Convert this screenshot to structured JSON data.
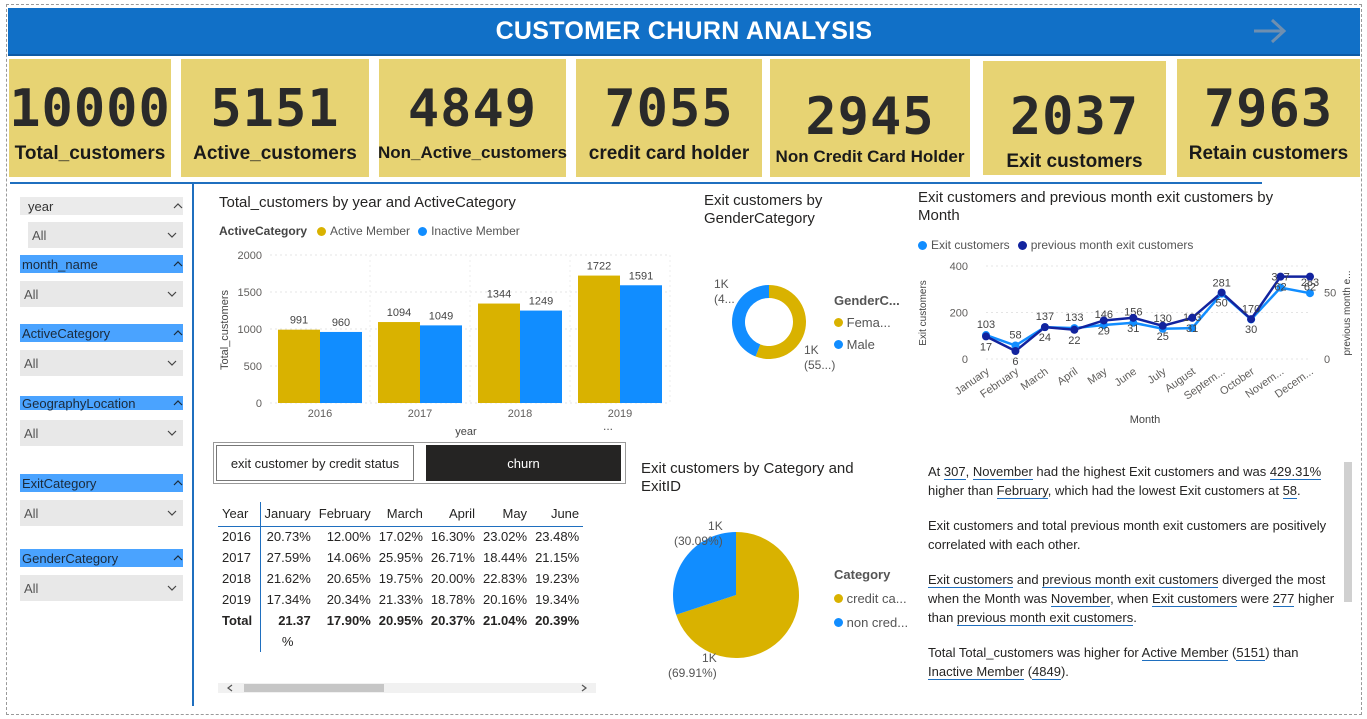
{
  "header": {
    "title": "CUSTOMER CHURN ANALYSIS",
    "nav_icon": "arrow-right-icon"
  },
  "kpis": [
    {
      "value": "10000",
      "label": "Total_customers"
    },
    {
      "value": "5151",
      "label": "Active_customers"
    },
    {
      "value": "4849",
      "label": "Non_Active_customers"
    },
    {
      "value": "7055",
      "label": "credit card holder"
    },
    {
      "value": "2945",
      "label": "Non Credit Card Holder"
    },
    {
      "value": "2037",
      "label": "Exit customers"
    },
    {
      "value": "7963",
      "label": "Retain customers"
    }
  ],
  "slicers": [
    {
      "field": "year",
      "selected": "All"
    },
    {
      "field": "month_name",
      "selected": "All"
    },
    {
      "field": "ActiveCategory",
      "selected": "All"
    },
    {
      "field": "GeographyLocation",
      "selected": "All"
    },
    {
      "field": "ExitCategory",
      "selected": "All"
    },
    {
      "field": "GenderCategory",
      "selected": "All"
    }
  ],
  "colors": {
    "gold": "#d9b200",
    "blue": "#118dff",
    "navy": "#12239e",
    "header": "#1170c7",
    "kpi_bg": "#e7d373"
  },
  "bar_chart": {
    "title": "Total_customers by year and ActiveCategory",
    "legend_title": "ActiveCategory",
    "xlabel": "year",
    "ylabel": "Total_customers",
    "yticks": [
      "2000",
      "1500",
      "1000",
      "500",
      "0"
    ],
    "more_icon": "..."
  },
  "donut": {
    "title_line1": "Exit customers by",
    "title_line2": "GenderCategory",
    "legend_title": "GenderC...",
    "legend": [
      "Fema...",
      "Male"
    ],
    "label_left_1": "1K",
    "label_left_2": "(4...",
    "label_right_1": "1K",
    "label_right_2": "(55...)"
  },
  "line_chart": {
    "title_line1": "Exit customers and previous month exit customers by",
    "title_line2": "Month",
    "legend": [
      "Exit customers",
      "previous month exit customers"
    ],
    "xlabel": "Month",
    "ylabel_left": "Exit customers",
    "ylabel_right": "previous month e...",
    "yticks_left": [
      "400",
      "200",
      "0"
    ],
    "yticks_right": [
      "50",
      "0"
    ],
    "months": [
      "January",
      "February",
      "March",
      "April",
      "May",
      "June",
      "July",
      "August",
      "Septem...",
      "October",
      "Novem...",
      "Decem..."
    ]
  },
  "toggle": {
    "left": "exit customer by credit status",
    "right": "churn"
  },
  "matrix": {
    "columns": [
      "Year",
      "January",
      "February",
      "March",
      "April",
      "May",
      "June"
    ],
    "rows": [
      [
        "2016",
        "20.73%",
        "12.00%",
        "17.02%",
        "16.30%",
        "23.02%",
        "23.48%"
      ],
      [
        "2017",
        "27.59%",
        "14.06%",
        "25.95%",
        "26.71%",
        "18.44%",
        "21.15%"
      ],
      [
        "2018",
        "21.62%",
        "20.65%",
        "19.75%",
        "20.00%",
        "22.83%",
        "19.23%"
      ],
      [
        "2019",
        "17.34%",
        "20.34%",
        "21.33%",
        "18.78%",
        "20.16%",
        "19.34%"
      ]
    ],
    "total": [
      "Total",
      "21.37",
      "17.90%",
      "20.95%",
      "20.37%",
      "21.04%",
      "20.39%"
    ],
    "total_wrap": "%"
  },
  "pie": {
    "title_line1": "Exit customers by Category and",
    "title_line2": "ExitID",
    "legend_title": "Category",
    "legend": [
      "credit ca...",
      "non cred..."
    ],
    "label_top_1": "1K",
    "label_top_2": "(30.09%)",
    "label_bottom_1": "1K",
    "label_bottom_2": "(69.91%)"
  },
  "narrative": {
    "p1": {
      "a": "At ",
      "b": "307",
      "c": ", ",
      "d": "November",
      "e": " had the highest Exit customers and was ",
      "f": "429.31%",
      "g": " higher than ",
      "h": "February",
      "i": ", which had the lowest Exit customers at ",
      "j": "58",
      "k": "."
    },
    "p2": "Exit customers and total previous month exit customers are positively correlated with each other.",
    "p3": {
      "a": "Exit customers",
      "b": " and ",
      "c": "previous month exit customers",
      "d": " diverged the most when the Month was ",
      "e": "November",
      "f": ", when ",
      "g": "Exit customers",
      "h": " were ",
      "i": "277",
      "j": " higher than ",
      "k": "previous month exit customers",
      "l": "."
    },
    "p4": {
      "a": "Total Total_customers was higher for ",
      "b": "Active Member",
      "c": " (",
      "d": "5151",
      "e": ") than ",
      "f": "Inactive Member",
      "g": " (",
      "h": "4849",
      "i": ")."
    }
  },
  "chart_data": [
    {
      "type": "bar",
      "title": "Total_customers by year and ActiveCategory",
      "categories": [
        "2016",
        "2017",
        "2018",
        "2019"
      ],
      "series": [
        {
          "name": "Active Member",
          "values": [
            991,
            1094,
            1344,
            1722
          ]
        },
        {
          "name": "Inactive Member",
          "values": [
            960,
            1049,
            1249,
            1591
          ]
        }
      ],
      "xlabel": "year",
      "ylabel": "Total_customers",
      "ylim": [
        0,
        2000
      ],
      "grid": true,
      "legend": "top"
    },
    {
      "type": "pie",
      "title": "Exit customers by GenderCategory",
      "categories": [
        "Female",
        "Male"
      ],
      "values": [
        1139,
        898
      ],
      "donut": true
    },
    {
      "type": "line",
      "title": "Exit customers and previous month exit customers by Month",
      "categories": [
        "January",
        "February",
        "March",
        "April",
        "May",
        "June",
        "July",
        "August",
        "Septem...",
        "October",
        "Novem...",
        "Decem..."
      ],
      "series": [
        {
          "name": "Exit customers",
          "values": [
            103,
            58,
            137,
            133,
            146,
            156,
            130,
            133,
            281,
            170,
            307,
            283
          ]
        },
        {
          "name": "previous month exit customers",
          "values": [
            17,
            6,
            24,
            22,
            29,
            31,
            25,
            31,
            50,
            30,
            62,
            62
          ],
          "axis": "right"
        }
      ],
      "xlabel": "Month",
      "ylim": [
        0,
        400
      ],
      "y2lim": [
        0,
        70
      ]
    },
    {
      "type": "pie",
      "title": "Exit customers by Category and ExitID",
      "categories": [
        "credit card holder",
        "non credit card holder"
      ],
      "values": [
        69.91,
        30.09
      ]
    }
  ]
}
